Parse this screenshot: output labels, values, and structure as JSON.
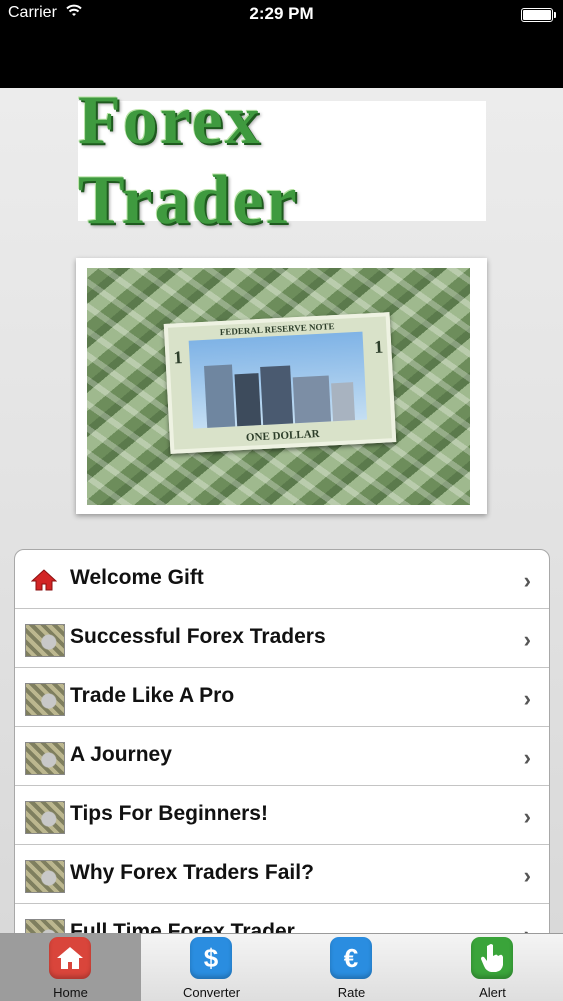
{
  "status_bar": {
    "carrier": "Carrier",
    "time": "2:29 PM"
  },
  "logo": {
    "text": "Forex Trader"
  },
  "banner": {
    "top_note": "FEDERAL RESERVE NOTE",
    "denomination": "1",
    "bottom_note": "ONE DOLLAR"
  },
  "menu": {
    "items": [
      {
        "label": "Welcome Gift",
        "icon": "home-icon"
      },
      {
        "label": "Successful Forex Traders",
        "icon": "coin-thumbnail-icon"
      },
      {
        "label": "Trade Like A Pro",
        "icon": "coin-thumbnail-icon"
      },
      {
        "label": "A Journey",
        "icon": "coin-thumbnail-icon"
      },
      {
        "label": "Tips For Beginners!",
        "icon": "coin-thumbnail-icon"
      },
      {
        "label": "Why Forex Traders Fail?",
        "icon": "coin-thumbnail-icon"
      },
      {
        "label": "Full Time Forex Trader",
        "icon": "coin-thumbnail-icon"
      }
    ]
  },
  "tabs": [
    {
      "label": "Home",
      "icon": "home-icon",
      "color": "#d9453b",
      "active": true
    },
    {
      "label": "Converter",
      "icon": "dollar-icon",
      "color": "#2a8de0",
      "active": false
    },
    {
      "label": "Rate",
      "icon": "euro-icon",
      "color": "#2a8de0",
      "active": false
    },
    {
      "label": "Alert",
      "icon": "hand-pointer-icon",
      "color": "#3aa43a",
      "active": false
    }
  ]
}
